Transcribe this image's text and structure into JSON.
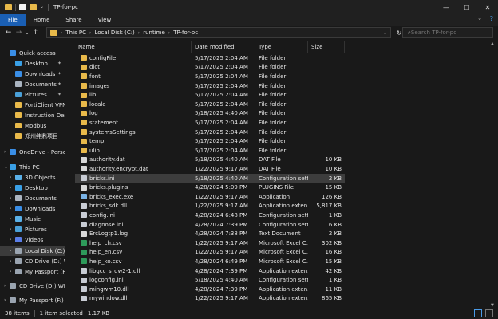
{
  "window": {
    "title": "TP-for-pc",
    "controls": {
      "minimize": "—",
      "maximize": "☐",
      "close": "✕"
    }
  },
  "ribbon": {
    "tabs": [
      "File",
      "Home",
      "Share",
      "View"
    ],
    "help_icon": "help-icon",
    "collapse_icon": "chevron-down-icon"
  },
  "address": {
    "crumbs": [
      "This PC",
      "Local Disk (C:)",
      "runtime",
      "TP-for-pc"
    ],
    "search_placeholder": "Search TP-for-pc"
  },
  "nav": {
    "items": [
      {
        "label": "Quick access",
        "icon": "star-icon",
        "color": "#3a8ee6",
        "indent": 0,
        "expand": "",
        "pinned": false
      },
      {
        "label": "Desktop",
        "icon": "desktop-icon",
        "color": "#3aa0e6",
        "indent": 1,
        "expand": "",
        "pinned": true
      },
      {
        "label": "Downloads",
        "icon": "download-icon",
        "color": "#3a8ee6",
        "indent": 1,
        "expand": "",
        "pinned": true
      },
      {
        "label": "Documents",
        "icon": "documents-icon",
        "color": "#aab4c0",
        "indent": 1,
        "expand": "",
        "pinned": true
      },
      {
        "label": "Pictures",
        "icon": "pictures-icon",
        "color": "#4aa0d8",
        "indent": 1,
        "expand": "",
        "pinned": true
      },
      {
        "label": "FortiClient VPN",
        "icon": "folder-icon",
        "color": "#e8b94a",
        "indent": 1,
        "expand": "",
        "pinned": false
      },
      {
        "label": "Instruction Desc",
        "icon": "folder-icon",
        "color": "#e8b94a",
        "indent": 1,
        "expand": "",
        "pinned": false
      },
      {
        "label": "Modbus",
        "icon": "folder-icon",
        "color": "#e8b94a",
        "indent": 1,
        "expand": "",
        "pinned": false
      },
      {
        "label": "郑州纬鼎项目",
        "icon": "folder-icon",
        "color": "#e8b94a",
        "indent": 1,
        "expand": "",
        "pinned": false
      },
      {
        "label": "OneDrive - Person",
        "icon": "cloud-icon",
        "color": "#3a8ee6",
        "indent": 0,
        "expand": "›",
        "pinned": false
      },
      {
        "label": "This PC",
        "icon": "pc-icon",
        "color": "#3aa0e6",
        "indent": 0,
        "expand": "⌄",
        "pinned": false
      },
      {
        "label": "3D Objects",
        "icon": "cube-icon",
        "color": "#5ab0e8",
        "indent": 1,
        "expand": "›",
        "pinned": false
      },
      {
        "label": "Desktop",
        "icon": "desktop-icon",
        "color": "#3aa0e6",
        "indent": 1,
        "expand": "›",
        "pinned": false
      },
      {
        "label": "Documents",
        "icon": "documents-icon",
        "color": "#aab4c0",
        "indent": 1,
        "expand": "›",
        "pinned": false
      },
      {
        "label": "Downloads",
        "icon": "download-icon",
        "color": "#3a8ee6",
        "indent": 1,
        "expand": "›",
        "pinned": false
      },
      {
        "label": "Music",
        "icon": "music-icon",
        "color": "#5ab0e8",
        "indent": 1,
        "expand": "›",
        "pinned": false
      },
      {
        "label": "Pictures",
        "icon": "pictures-icon",
        "color": "#4aa0d8",
        "indent": 1,
        "expand": "›",
        "pinned": false
      },
      {
        "label": "Videos",
        "icon": "video-icon",
        "color": "#5a7ee8",
        "indent": 1,
        "expand": "›",
        "pinned": false
      },
      {
        "label": "Local Disk (C:)",
        "icon": "disk-icon",
        "color": "#9aa4b0",
        "indent": 1,
        "expand": "›",
        "pinned": false,
        "selected": true
      },
      {
        "label": "CD Drive (D:) WD",
        "icon": "cd-icon",
        "color": "#9aa4b0",
        "indent": 1,
        "expand": "›",
        "pinned": false
      },
      {
        "label": "My Passport (F:)",
        "icon": "drive-icon",
        "color": "#9aa4b0",
        "indent": 1,
        "expand": "›",
        "pinned": false
      },
      {
        "label": "CD Drive (D:) WD",
        "icon": "cd-icon",
        "color": "#9aa4b0",
        "indent": 0,
        "expand": "›",
        "pinned": false
      },
      {
        "label": "My Passport (F:)",
        "icon": "drive-icon",
        "color": "#9aa4b0",
        "indent": 0,
        "expand": "›",
        "pinned": false
      }
    ]
  },
  "columns": [
    "Name",
    "Date modified",
    "Type",
    "Size"
  ],
  "files": [
    {
      "name": "configFile",
      "date": "5/17/2025 2:04 AM",
      "type": "File folder",
      "size": "",
      "icon": "folder-icon",
      "color": "#e8b94a"
    },
    {
      "name": "dict",
      "date": "5/17/2025 2:04 AM",
      "type": "File folder",
      "size": "",
      "icon": "folder-icon",
      "color": "#e8b94a"
    },
    {
      "name": "font",
      "date": "5/17/2025 2:04 AM",
      "type": "File folder",
      "size": "",
      "icon": "folder-icon",
      "color": "#e8b94a"
    },
    {
      "name": "images",
      "date": "5/17/2025 2:04 AM",
      "type": "File folder",
      "size": "",
      "icon": "folder-icon",
      "color": "#e8b94a"
    },
    {
      "name": "lib",
      "date": "5/17/2025 2:04 AM",
      "type": "File folder",
      "size": "",
      "icon": "folder-icon",
      "color": "#e8b94a"
    },
    {
      "name": "locale",
      "date": "5/17/2025 2:04 AM",
      "type": "File folder",
      "size": "",
      "icon": "folder-icon",
      "color": "#e8b94a"
    },
    {
      "name": "log",
      "date": "5/18/2025 4:40 AM",
      "type": "File folder",
      "size": "",
      "icon": "folder-icon",
      "color": "#e8b94a"
    },
    {
      "name": "statement",
      "date": "5/17/2025 2:04 AM",
      "type": "File folder",
      "size": "",
      "icon": "folder-icon",
      "color": "#e8b94a"
    },
    {
      "name": "systemsSettings",
      "date": "5/17/2025 2:04 AM",
      "type": "File folder",
      "size": "",
      "icon": "folder-icon",
      "color": "#e8b94a"
    },
    {
      "name": "temp",
      "date": "5/17/2025 2:04 AM",
      "type": "File folder",
      "size": "",
      "icon": "folder-icon",
      "color": "#e8b94a"
    },
    {
      "name": "ulib",
      "date": "5/17/2025 2:04 AM",
      "type": "File folder",
      "size": "",
      "icon": "folder-icon",
      "color": "#e8b94a"
    },
    {
      "name": "authority.dat",
      "date": "5/18/2025 4:40 AM",
      "type": "DAT File",
      "size": "10 KB",
      "icon": "file-icon",
      "color": "#d8d8d8"
    },
    {
      "name": "authority.encrypt.dat",
      "date": "1/22/2025 9:17 AM",
      "type": "DAT File",
      "size": "10 KB",
      "icon": "file-icon",
      "color": "#d8d8d8"
    },
    {
      "name": "bricks.ini",
      "date": "5/18/2025 4:40 AM",
      "type": "Configuration sett...",
      "size": "2 KB",
      "icon": "config-icon",
      "color": "#c8ccd4",
      "selected": true
    },
    {
      "name": "bricks.plugins",
      "date": "4/28/2024 5:09 PM",
      "type": "PLUGINS File",
      "size": "15 KB",
      "icon": "file-icon",
      "color": "#d8d8d8"
    },
    {
      "name": "bricks_exec.exe",
      "date": "1/22/2025 9:17 AM",
      "type": "Application",
      "size": "126 KB",
      "icon": "exe-icon",
      "color": "#7ab4e8"
    },
    {
      "name": "bricks_sdk.dll",
      "date": "1/22/2025 9:17 AM",
      "type": "Application exten...",
      "size": "5,817 KB",
      "icon": "dll-icon",
      "color": "#c8ccd4"
    },
    {
      "name": "config.ini",
      "date": "4/28/2024 6:48 PM",
      "type": "Configuration sett...",
      "size": "1 KB",
      "icon": "config-icon",
      "color": "#c8ccd4"
    },
    {
      "name": "diagnose.ini",
      "date": "4/28/2024 7:39 PM",
      "type": "Configuration sett...",
      "size": "6 KB",
      "icon": "config-icon",
      "color": "#c8ccd4"
    },
    {
      "name": "ErcLogtp1.log",
      "date": "4/28/2024 7:38 PM",
      "type": "Text Document",
      "size": "2 KB",
      "icon": "text-icon",
      "color": "#d8d8d8"
    },
    {
      "name": "help_ch.csv",
      "date": "1/22/2025 9:17 AM",
      "type": "Microsoft Excel C...",
      "size": "302 KB",
      "icon": "excel-icon",
      "color": "#2e9a5a"
    },
    {
      "name": "help_en.csv",
      "date": "1/22/2025 9:17 AM",
      "type": "Microsoft Excel C...",
      "size": "16 KB",
      "icon": "excel-icon",
      "color": "#2e9a5a"
    },
    {
      "name": "help_ko.csv",
      "date": "4/28/2024 6:49 PM",
      "type": "Microsoft Excel C...",
      "size": "15 KB",
      "icon": "excel-icon",
      "color": "#2e9a5a"
    },
    {
      "name": "libgcc_s_dw2-1.dll",
      "date": "4/28/2024 7:39 PM",
      "type": "Application exten...",
      "size": "42 KB",
      "icon": "dll-icon",
      "color": "#c8ccd4"
    },
    {
      "name": "logconfig.ini",
      "date": "5/18/2025 4:40 AM",
      "type": "Configuration sett...",
      "size": "1 KB",
      "icon": "config-icon",
      "color": "#c8ccd4"
    },
    {
      "name": "mingwm10.dll",
      "date": "4/28/2024 7:39 PM",
      "type": "Application exten...",
      "size": "11 KB",
      "icon": "dll-icon",
      "color": "#c8ccd4"
    },
    {
      "name": "mywindow.dll",
      "date": "1/22/2025 9:17 AM",
      "type": "Application exten...",
      "size": "865 KB",
      "icon": "dll-icon",
      "color": "#c8ccd4"
    }
  ],
  "status": {
    "count": "38 items",
    "selection": "1 item selected",
    "size": "1.17 KB"
  }
}
